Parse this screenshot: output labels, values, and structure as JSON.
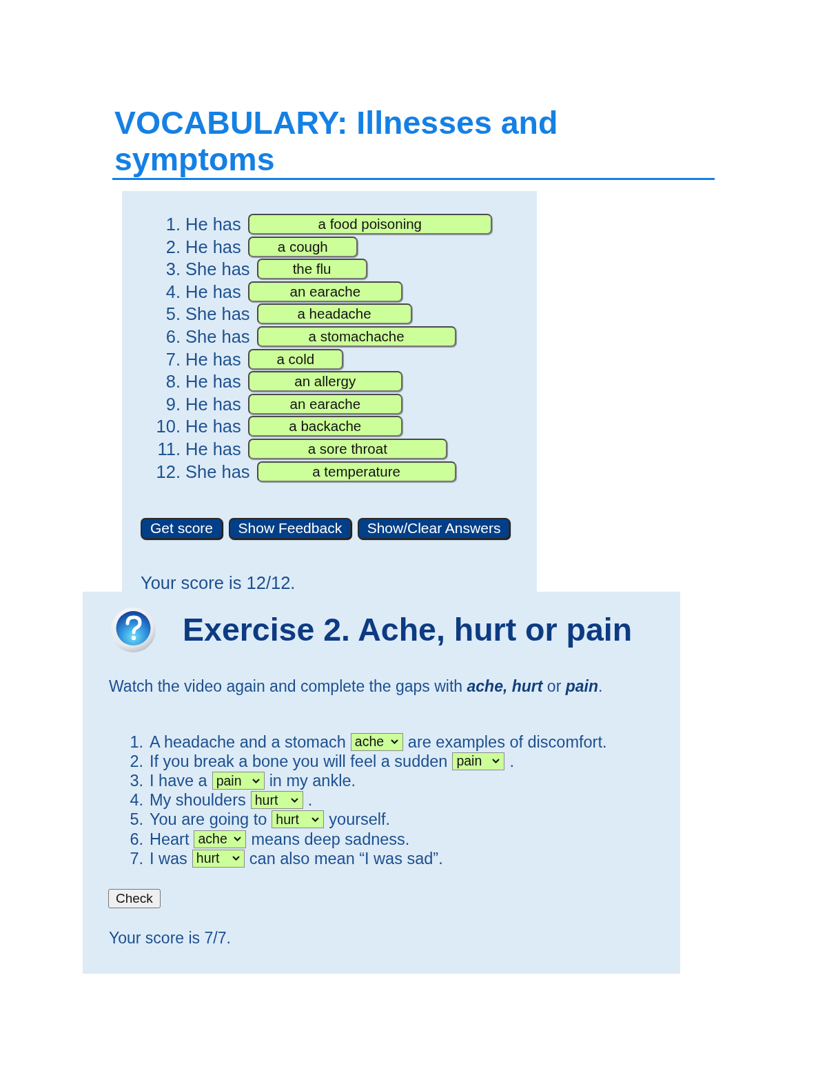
{
  "title": "VOCABULARY: Illnesses and symptoms",
  "exercise_1": {
    "items": [
      {
        "number": "1.",
        "prompt": "He has",
        "answer": "a food poisoning"
      },
      {
        "number": "2.",
        "prompt": "He has",
        "answer": "a cough"
      },
      {
        "number": "3.",
        "prompt": "She has",
        "answer": "the flu"
      },
      {
        "number": "4.",
        "prompt": "He has",
        "answer": "an earache"
      },
      {
        "number": "5.",
        "prompt": "She has",
        "answer": "a headache"
      },
      {
        "number": "6.",
        "prompt": "She has",
        "answer": "a stomachache"
      },
      {
        "number": "7.",
        "prompt": "He has",
        "answer": "a cold"
      },
      {
        "number": "8.",
        "prompt": "He has",
        "answer": "an allergy"
      },
      {
        "number": "9.",
        "prompt": "He has",
        "answer": "an earache"
      },
      {
        "number": "10.",
        "prompt": "He has",
        "answer": "a backache"
      },
      {
        "number": "11.",
        "prompt": "He has",
        "answer": "a sore throat"
      },
      {
        "number": "12.",
        "prompt": "She has",
        "answer": "a temperature"
      }
    ],
    "buttons": [
      "Get score",
      "Show Feedback",
      "Show/Clear Answers"
    ],
    "score": "Your score is 12/12."
  },
  "exercise_2": {
    "title": "Exercise 2. Ache, hurt or pain",
    "instruction": "Watch the video again and complete the gaps with **ache, hurt** or **pain**.",
    "items": [
      {
        "number": "1.",
        "before": "A headache and a stomach",
        "answer": "ache",
        "after": "are examples of discomfort.",
        "correct": true
      },
      {
        "number": "2.",
        "before": "If you break a bone you will feel a sudden",
        "answer": "pain",
        "after": ".",
        "correct": true
      },
      {
        "number": "3.",
        "before": "I have a",
        "answer": "pain",
        "after": "in my ankle.",
        "correct": true
      },
      {
        "number": "4.",
        "before": "My shoulders",
        "answer": "hurt",
        "after": ".",
        "correct": true
      },
      {
        "number": "5.",
        "before": "You are going to",
        "answer": "hurt",
        "after": "yourself.",
        "correct": true
      },
      {
        "number": "6.",
        "before": "Heart",
        "answer": "ache",
        "after": "means deep sadness.",
        "correct": true
      },
      {
        "number": "7.",
        "before": "I was",
        "answer": "hurt",
        "after": "can also mean “I was sad”.",
        "correct": true
      }
    ],
    "check_button": "Check",
    "score": "Your score is 7/7."
  }
}
